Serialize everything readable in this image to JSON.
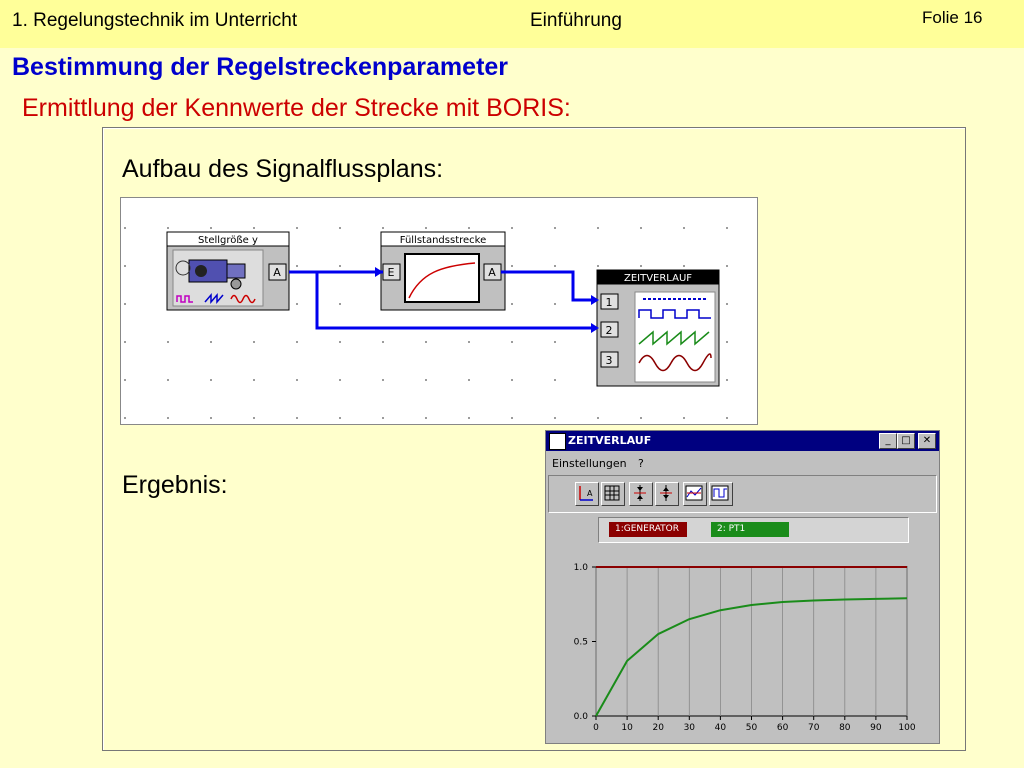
{
  "header": {
    "left": "1. Regelungstechnik im Unterricht",
    "center": "Einführung",
    "right": "Folie 16"
  },
  "title": "Bestimmung der Regelstreckenparameter",
  "subtitle": "Ermittlung der Kennwerte der Strecke mit BORIS:",
  "labels": {
    "aufbau": "Aufbau des Signalflussplans:",
    "ergebnis": "Ergebnis:"
  },
  "diagram": {
    "block1": {
      "title": "Stellgröße y",
      "port_out": "A"
    },
    "block2": {
      "title": "Füllstandsstrecke",
      "port_in": "E",
      "port_out": "A"
    },
    "block3": {
      "title": "ZEITVERLAUF",
      "ports": [
        "1",
        "2",
        "3"
      ]
    }
  },
  "window": {
    "title": "ZEITVERLAUF",
    "buttons": {
      "minimize": "_",
      "maximize": "□",
      "close": "✕"
    },
    "menu": [
      "Einstellungen",
      "?"
    ]
  },
  "colors": {
    "generator": "#8b0000",
    "pt1": "#1a8c1a",
    "wire": "#0000ee",
    "title_blue": "#0000cc",
    "subtitle_red": "#cc0000"
  },
  "chart_data": {
    "type": "line",
    "x": [
      0,
      10,
      20,
      30,
      40,
      50,
      60,
      70,
      80,
      90,
      100
    ],
    "series": [
      {
        "name": "1:GENERATOR",
        "values": [
          1.0,
          1.0,
          1.0,
          1.0,
          1.0,
          1.0,
          1.0,
          1.0,
          1.0,
          1.0,
          1.0
        ]
      },
      {
        "name": "2: PT1",
        "values": [
          0.0,
          0.37,
          0.55,
          0.65,
          0.71,
          0.745,
          0.765,
          0.775,
          0.782,
          0.786,
          0.79
        ]
      }
    ],
    "xticks": [
      "0",
      "10",
      "20",
      "30",
      "40",
      "50",
      "60",
      "70",
      "80",
      "90",
      "100"
    ],
    "yticks": [
      "0.0",
      "0.5",
      "1.0"
    ],
    "xlim": [
      0,
      100
    ],
    "ylim": [
      0,
      1.0
    ],
    "grid": true
  }
}
